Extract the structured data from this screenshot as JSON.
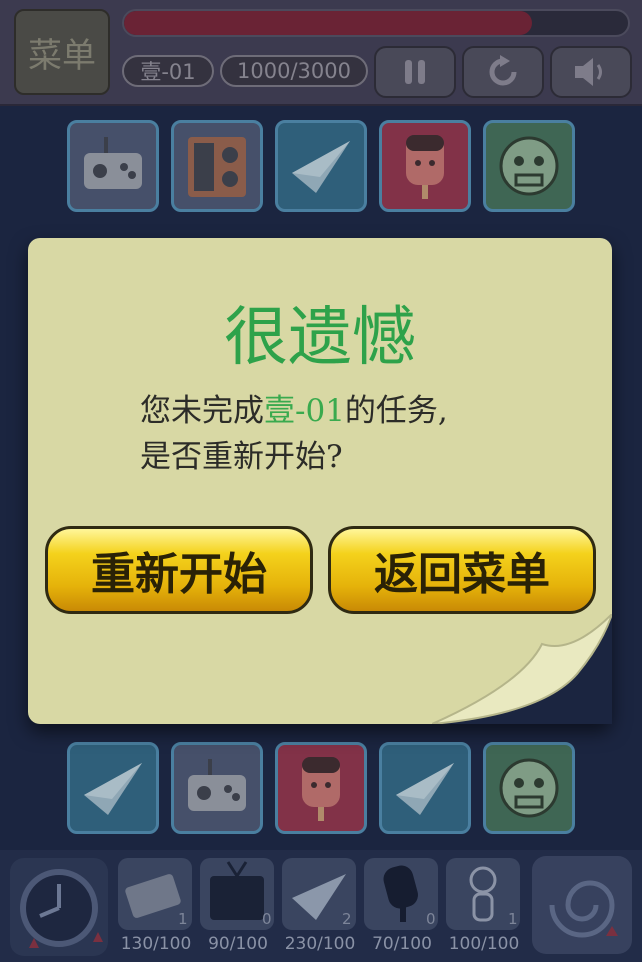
{
  "top": {
    "menu_label": "菜单",
    "level_name": "壹-01",
    "score": "1000/3000",
    "time_progress": 0.81
  },
  "icons": {
    "pause": "pause-icon",
    "restart": "restart-icon",
    "sound": "sound-icon"
  },
  "board": {
    "row1": [
      "gamepad",
      "radio",
      "paper-plane",
      "popsicle",
      "face"
    ],
    "row2": [
      "paper-plane",
      "gamepad",
      "popsicle",
      "paper-plane",
      "face"
    ]
  },
  "dialog": {
    "title": "很遗憾",
    "message_prefix": "您未完成",
    "message_level": "壹-01",
    "message_suffix": "的任务,",
    "message_line2": "是否重新开始?",
    "restart_label": "重新开始",
    "back_label": "返回菜单"
  },
  "items": [
    {
      "icon": "cassette-icon",
      "count": "1",
      "caption": "130/100"
    },
    {
      "icon": "tv-icon",
      "count": "0",
      "caption": "90/100"
    },
    {
      "icon": "paper-plane-icon",
      "count": "2",
      "caption": "230/100"
    },
    {
      "icon": "popsicle-icon",
      "count": "0",
      "caption": "70/100"
    },
    {
      "icon": "monkey-icon",
      "count": "1",
      "caption": "100/100"
    }
  ]
}
